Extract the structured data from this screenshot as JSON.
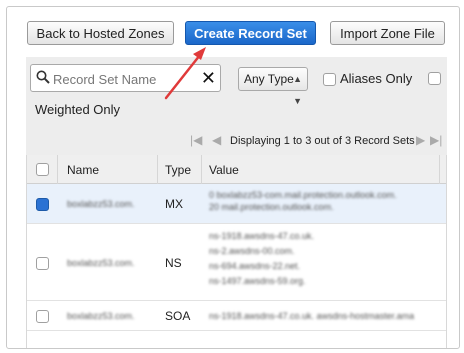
{
  "toolbar": {
    "back_label": "Back to Hosted Zones",
    "create_label": "Create Record Set",
    "import_label": "Import Zone File"
  },
  "filter": {
    "search_placeholder": "Record Set Name",
    "clear_glyph": "✕",
    "type_select": "Any Type",
    "aliases_label": "Aliases Only",
    "weighted_label": "Weighted Only"
  },
  "pager": {
    "first_glyph": "|◀",
    "prev_glyph": "◀",
    "text": "Displaying 1 to 3 out of 3 Record Sets",
    "next_glyph": "▶",
    "last_glyph": "▶|"
  },
  "table": {
    "headers": {
      "name": "Name",
      "type": "Type",
      "value": "Value"
    },
    "rows": [
      {
        "name": "boxlabzz53.com.",
        "type": "MX",
        "selected": true,
        "values": [
          "0 boxlabzz53-com.mail.protection.outlook.com.",
          "20 mail.protection.outlook.com."
        ]
      },
      {
        "name": "boxlabzz53.com.",
        "type": "NS",
        "selected": false,
        "values": [
          "ns-1918.awsdns-47.co.uk.",
          "ns-2.awsdns-00.com.",
          "ns-694.awsdns-22.net.",
          "ns-1497.awsdns-59.org."
        ]
      },
      {
        "name": "boxlabzz53.com.",
        "type": "SOA",
        "selected": false,
        "values": [
          "ns-1918.awsdns-47.co.uk. awsdns-hostmaster.ama"
        ]
      }
    ]
  },
  "colors": {
    "primary_button": "#1b67c9",
    "annotation_arrow": "#e03a3a",
    "selected_row": "#e9f1fb"
  }
}
